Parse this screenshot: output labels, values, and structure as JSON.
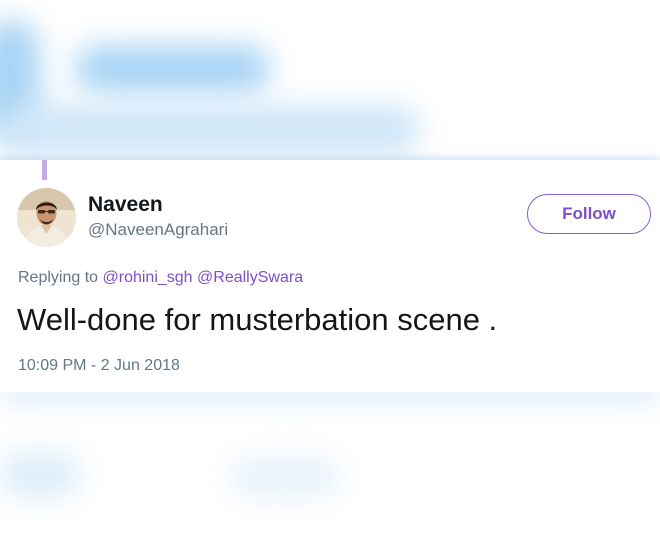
{
  "tweet": {
    "display_name": "Naveen",
    "handle": "@NaveenAgrahari",
    "follow_label": "Follow",
    "replying_prefix": "Replying to",
    "reply_mentions": [
      "@rohini_sgh",
      "@ReallySwara"
    ],
    "text": "Well-done for musterbation scene .",
    "timestamp": "10:09 PM - 2 Jun 2018"
  },
  "colors": {
    "accent": "#7c4fd0",
    "thread_line": "#c8a8ec",
    "text_primary": "#14171a",
    "text_secondary": "#657786",
    "blur_blue": "#a9d4f5"
  },
  "icons": {
    "avatar": "user-avatar-photo"
  }
}
